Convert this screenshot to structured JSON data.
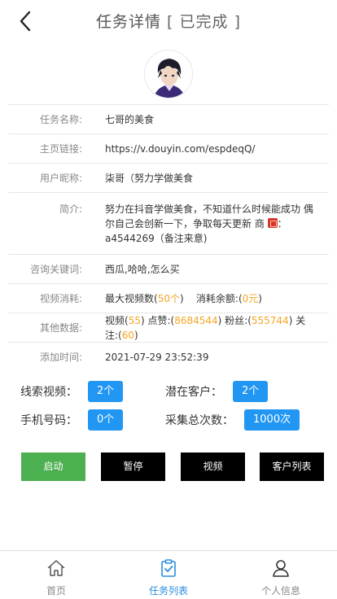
{
  "header": {
    "title": "任务详情",
    "status_open": "[",
    "status": "已完成",
    "status_close": "]"
  },
  "task": {
    "name_label": "任务名称:",
    "name": "七哥的美食",
    "homepage_label": "主页链接:",
    "homepage": "https://v.douyin.com/espdeqQ/",
    "nickname_label": "用户昵称:",
    "nickname": "柒哥（努力学做美食",
    "intro_label": "简介:",
    "intro_line1": "努力在抖音学做美食，不知道什么时候能成功 偶尔自己会创新一下，争取每天更新 商",
    "intro_line2": "：",
    "intro_line3": "a4544269（备注来意)",
    "keywords_label": "咨询关键词:",
    "keywords": "西瓜,哈哈,怎么买",
    "consumption_label": "视频消耗:",
    "max_videos_prefix": "最大视频数(",
    "max_videos": "50个",
    "max_videos_suffix": ")",
    "balance_prefix": "消耗余额:(",
    "balance": "0元",
    "balance_suffix": ")",
    "other_label": "其他数据:",
    "videos_prefix": "视频(",
    "videos": "55",
    "likes_prefix": ") 点赞:(",
    "likes": "8684544",
    "fans_prefix": ") 粉丝:(",
    "fans": "555744",
    "follows_prefix": ") 关注:(",
    "follows": "60",
    "follows_suffix": ")",
    "added_label": "添加时间:",
    "added_time": "2021-07-29 23:52:39"
  },
  "stats": {
    "lead_videos_label": "线索视频：",
    "lead_videos": "2个",
    "potential_label": "潜在客户：",
    "potential": "2个",
    "phone_label": "手机号码：",
    "phone": "0个",
    "collect_label": "采集总次数：",
    "collect": "1000次"
  },
  "actions": {
    "start": "启动",
    "pause": "暂停",
    "video": "视频",
    "customers": "客户列表"
  },
  "tabs": {
    "home": "首页",
    "tasks": "任务列表",
    "profile": "个人信息"
  },
  "colors": {
    "accent_blue": "#2196f3",
    "start_green": "#4caf50",
    "dark_button": "#000000",
    "highlight_orange": "#f5a623",
    "active_tab": "#2a8de0"
  }
}
